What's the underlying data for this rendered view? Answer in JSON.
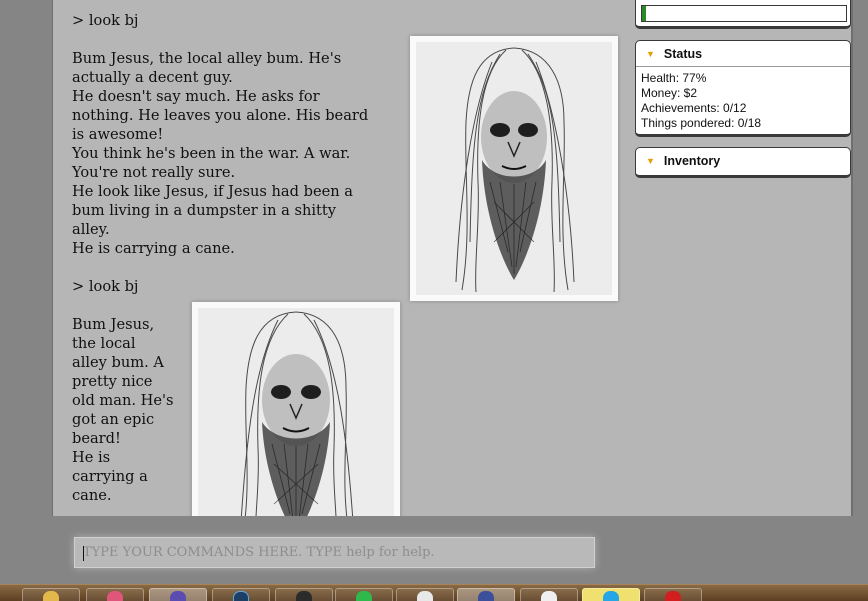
{
  "transcript": {
    "command_1": "> look bj",
    "description_1": [
      "Bum Jesus, the local alley bum. He's",
      "actually a decent guy.",
      "He doesn't say much. He asks for",
      "nothing. He leaves you alone. His beard",
      "is awesome!",
      "You think he's been in the war. A war.",
      "You're not really sure.",
      "He look like Jesus, if Jesus had been a",
      "bum living in a dumpster in a shitty",
      "alley.",
      "He is carrying a cane."
    ],
    "command_2": "> look bj",
    "description_2": [
      "Bum Jesus,",
      "the local",
      "alley bum. A",
      "pretty nice",
      "old man. He's",
      "got an epic",
      "beard!",
      "He is",
      "carrying a",
      "cane."
    ]
  },
  "sidebar": {
    "progress_fraction": 0.02,
    "status": {
      "title": "Status",
      "health": "Health: 77%",
      "money": "Money: $2",
      "achievements": "Achievements: 0/12",
      "pondered": "Things pondered: 0/18"
    },
    "inventory": {
      "title": "Inventory"
    }
  },
  "command_input": {
    "placeholder": "TYPE YOUR COMMANDS HERE. TYPE help for help."
  },
  "taskbar": {
    "icons": [
      "folder-icon",
      "itunes-icon",
      "media-icon",
      "photoshop-icon",
      "browser-icon",
      "spotify-icon",
      "documents-icon",
      "network-icon",
      "notepad-icon",
      "skype-icon",
      "flash-icon"
    ]
  },
  "colors": {
    "progress": "#2a8a2a",
    "accent_triangle": "#e5a000",
    "pane_bg": "#b6b6b6"
  }
}
